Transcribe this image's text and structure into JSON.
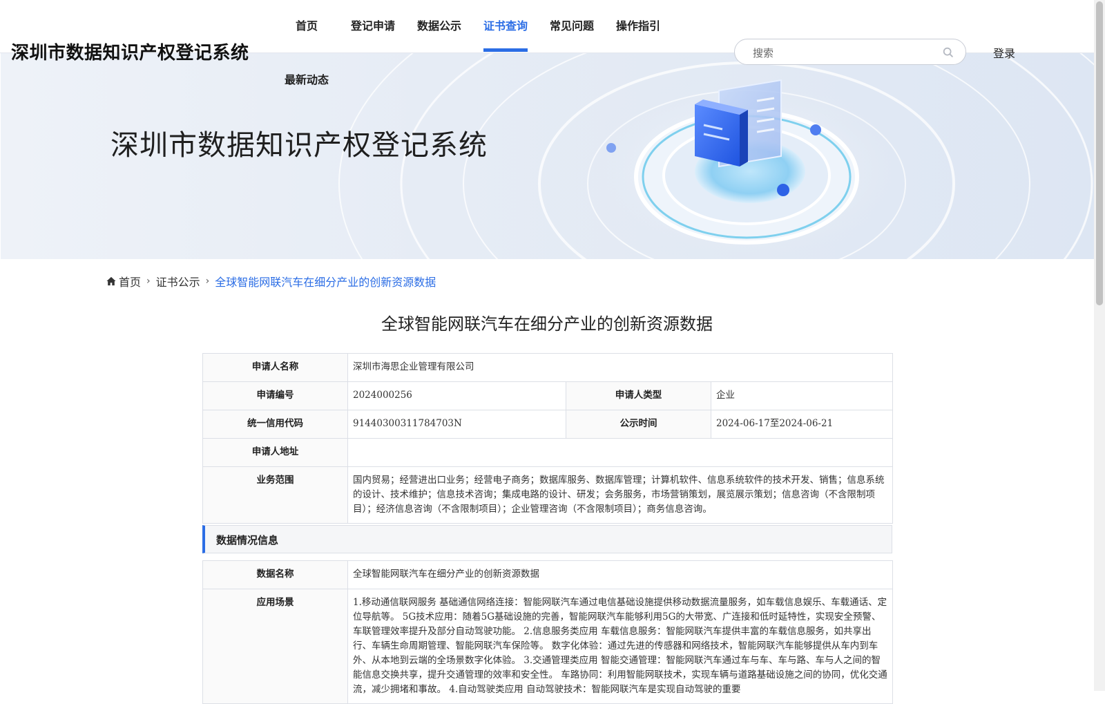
{
  "site": {
    "title": "深圳市数据知识产权登记系统"
  },
  "nav": {
    "items": [
      {
        "label": "首页"
      },
      {
        "label": "登记申请"
      },
      {
        "label": "数据公示"
      },
      {
        "label": "证书查询"
      },
      {
        "label": "常见问题"
      },
      {
        "label": "操作指引"
      }
    ],
    "active": "证书查询",
    "second_row": "最新动态"
  },
  "search": {
    "placeholder": "搜索"
  },
  "login": "登录",
  "banner": {
    "title": "深圳市数据知识产权登记系统"
  },
  "breadcrumb": {
    "home": "首页",
    "level1": "证书公示",
    "current": "全球智能网联汽车在细分产业的创新资源数据"
  },
  "page_title": "全球智能网联汽车在细分产业的创新资源数据",
  "applicant": {
    "name_label": "申请人名称",
    "name_value": "深圳市海思企业管理有限公司",
    "number_label": "申请编号",
    "number_value": "2024000256",
    "type_label": "申请人类型",
    "type_value": "企业",
    "credit_label": "统一信用代码",
    "credit_value": "91440300311784703N",
    "time_label": "公示时间",
    "time_value": "2024-06-17至2024-06-21",
    "address_label": "申请人地址",
    "address_value": "",
    "scope_label": "业务范围",
    "scope_value": "国内贸易；经营进出口业务；经营电子商务；数据库服务、数据库管理；计算机软件、信息系统软件的技术开发、销售；信息系统的设计、技术维护；信息技术咨询；集成电路的设计、研发；会务服务，市场营销策划，展览展示策划；信息咨询（不含限制项目）；经济信息咨询（不含限制项目）；企业管理咨询（不含限制项目）；商务信息咨询。"
  },
  "data_section": {
    "heading": "数据情况信息",
    "name_label": "数据名称",
    "name_value": "全球智能网联汽车在细分产业的创新资源数据",
    "scene_label": "应用场景",
    "scene_value": "1.移动通信联网服务 基础通信网络连接：智能网联汽车通过电信基础设施提供移动数据流量服务，如车载信息娱乐、车载通话、定位导航等。 5G技术应用：随着5G基础设施的完善，智能网联汽车能够利用5G的大带宽、广连接和低时延特性，实现安全预警、车联管理效率提升及部分自动驾驶功能。 2.信息服务类应用 车载信息服务：智能网联汽车提供丰富的车载信息服务，如共享出行、车辆生命周期管理、智能网联汽车保险等。 数字化体验：通过先进的传感器和网络技术，智能网联汽车能够提供从车内到车外、从本地到云端的全场景数字化体验。 3.交通管理类应用 智能交通管理：智能网联汽车通过车与车、车与路、车与人之间的智能信息交换共享，提升交通管理的效率和安全性。 车路协同：利用智能网联技术，实现车辆与道路基础设施之间的协同，优化交通流，减少拥堵和事故。 4.自动驾驶类应用 自动驾驶技术：智能网联汽车是实现自动驾驶的重要"
  }
}
